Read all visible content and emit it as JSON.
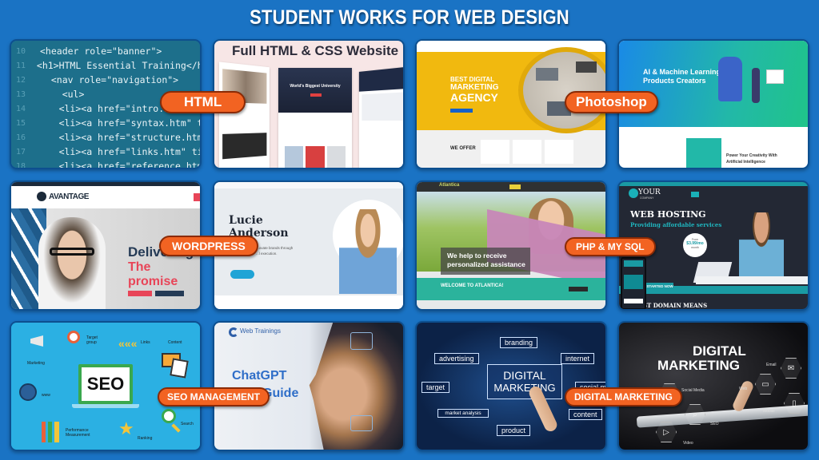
{
  "page_title": "STUDENT WORKS FOR WEB DESIGN",
  "colors": {
    "background": "#1a73c4",
    "badge": "#f26322",
    "title_text": "#ffffff"
  },
  "badges": [
    {
      "label": "HTML"
    },
    {
      "label": "Photoshop"
    },
    {
      "label": "WORDPRESS"
    },
    {
      "label": "PHP & MY SQL"
    },
    {
      "label": "SEO MANAGEMENT"
    },
    {
      "label": "DIGITAL MARKETING"
    }
  ],
  "tiles": {
    "html_code": {
      "lines": [
        {
          "num": "10",
          "text": "<header role=\"banner\">"
        },
        {
          "num": "11",
          "text": "  <h1>HTML Essential Training</h1"
        },
        {
          "num": "12",
          "text": "  <nav role=\"navigation\">"
        },
        {
          "num": "13",
          "text": "    <ul>"
        },
        {
          "num": "14",
          "text": "      <li><a href=\"intro.htm\" ti"
        },
        {
          "num": "15",
          "text": "      <li><a href=\"syntax.htm\" ti"
        },
        {
          "num": "16",
          "text": "      <li><a href=\"structure.htm\""
        },
        {
          "num": "17",
          "text": "      <li><a href=\"links.htm\" tit"
        },
        {
          "num": "18",
          "text": "      <li><a href=\"reference.htm\""
        }
      ]
    },
    "html_css_site": {
      "heading": "Full HTML & CSS Website",
      "hero_text": "World's Biggest University"
    },
    "marketing_agency": {
      "line1": "BEST DIGITAL",
      "line2": "MARKETING",
      "line3": "AGENCY",
      "offer": "WE OFFER"
    },
    "ai_site": {
      "heading_line1": "AI & Machine Learning",
      "heading_line2": "Products Creators",
      "sub_line1": "Power Your Creativity With",
      "sub_line2": "Artificial Intelligence"
    },
    "avantage": {
      "logo": "AVANTAGE",
      "line1": "Delivering",
      "line2": "The promise"
    },
    "portfolio": {
      "name_line1": "Lucie",
      "name_line2": "Anderson",
      "desc_line1": "...ovate brands through",
      "desc_line2": "...l execution."
    },
    "atlantica": {
      "logo": "Atlantica",
      "banner_line1": "We help to receive",
      "banner_line2": "personalized assistance",
      "welcome": "WELCOME TO ATLANTICA!"
    },
    "hosting": {
      "logo": "YOUR",
      "logo_sub": "COMPANY",
      "heading": "WEB HOSTING",
      "sub": "Providing affordable services",
      "price_from": "From",
      "price": "$3.99/mo",
      "price_unit": "month",
      "cta": "STARTED NOW",
      "footer": "ST DOMAIN MEANS"
    },
    "seo": {
      "center": "SEO",
      "labels": [
        "Marketing",
        "Target group",
        "Links",
        "Content",
        "www",
        "Performance Measurement",
        "Ranking",
        "Search"
      ]
    },
    "chatgpt": {
      "brand": "Web Trainings",
      "line1": "ChatGPT",
      "line2": "Guide"
    },
    "digital_marketing_1": {
      "center_line1": "DIGITAL",
      "center_line2": "MARKETING",
      "words": [
        "branding",
        "advertising",
        "internet",
        "target",
        "social m",
        "market analysis",
        "content",
        "product"
      ]
    },
    "digital_marketing_2": {
      "line1": "DIGITAL",
      "line2": "MARKETING",
      "icons": [
        "Email",
        "Web",
        "Social Media",
        "Mobile",
        "SEO",
        "Video"
      ]
    }
  }
}
